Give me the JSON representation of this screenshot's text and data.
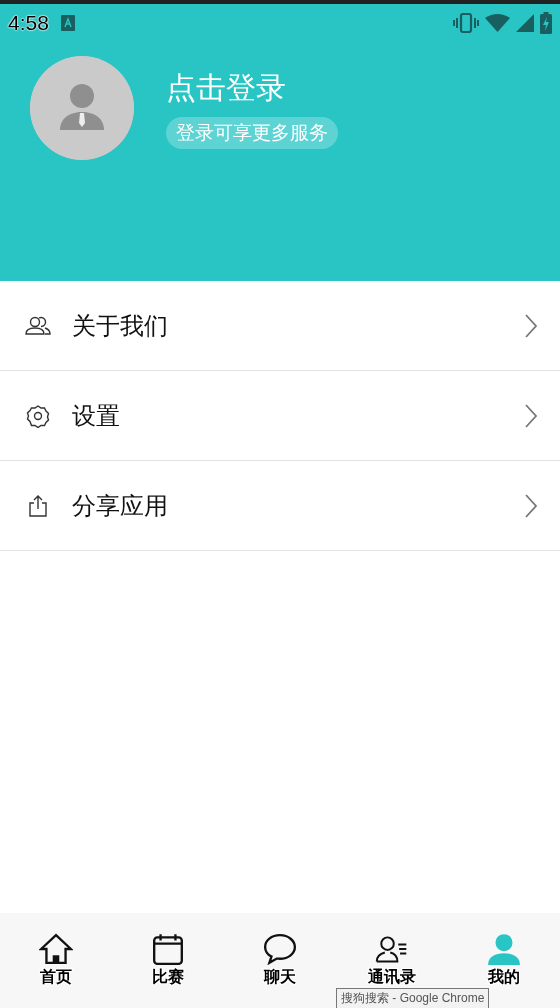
{
  "status_bar": {
    "time": "4:58"
  },
  "profile": {
    "title": "点击登录",
    "subtitle": "登录可享更多服务"
  },
  "menu": [
    {
      "kind": "people",
      "label": "关于我们"
    },
    {
      "kind": "gear",
      "label": "设置"
    },
    {
      "kind": "share",
      "label": "分享应用"
    }
  ],
  "tabs": [
    {
      "kind": "home",
      "label": "首页",
      "selected": false
    },
    {
      "kind": "calendar",
      "label": "比赛",
      "selected": false
    },
    {
      "kind": "chat",
      "label": "聊天",
      "selected": false
    },
    {
      "kind": "contacts",
      "label": "通讯录",
      "selected": false
    },
    {
      "kind": "person",
      "label": "我的",
      "selected": true
    }
  ],
  "tooltip": "搜狗搜索 - Google Chrome"
}
